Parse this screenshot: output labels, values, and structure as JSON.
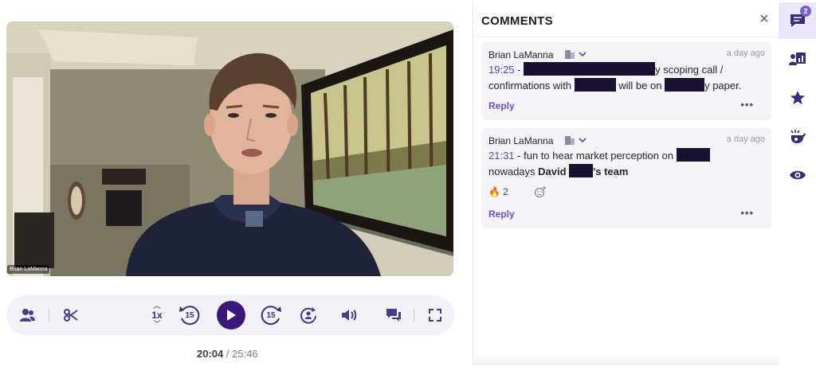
{
  "video": {
    "speaker_label": "Brian LaManna"
  },
  "player": {
    "speed": "1x",
    "skip_back_seconds": "15",
    "skip_forward_seconds": "15",
    "current_time": "20:04",
    "separator": "/",
    "duration": "25:46"
  },
  "comments_panel": {
    "title": "COMMENTS",
    "close_icon": "close-icon",
    "comments": [
      {
        "author": "Brian LaManna",
        "time_ago": "a day ago",
        "timestamp": "19:25",
        "text_1": " - ",
        "text_2": "y scoping call /",
        "text_3": "confirmations with ",
        "text_4": " will be on ",
        "text_5": "y paper.",
        "reply": "Reply",
        "more": "•••"
      },
      {
        "author": "Brian LaManna",
        "time_ago": "a day ago",
        "timestamp": "21:31",
        "text_1": " - fun to hear market perception on ",
        "text_2": "nowadays ",
        "text_3": "David ",
        "text_4": "'s team",
        "reaction_emoji": "🔥",
        "reaction_count": "2",
        "reply": "Reply",
        "more": "•••"
      }
    ]
  },
  "sidebar_rail": {
    "comments_badge": "2",
    "icons": [
      "comments-icon",
      "trackers-icon",
      "star-icon",
      "whistle-icon",
      "eye-icon"
    ]
  },
  "colors": {
    "accent": "#3a1a78",
    "link": "#6a4fc9",
    "timestamp": "#5b3fbf",
    "card_bg": "#f4f4f8"
  }
}
